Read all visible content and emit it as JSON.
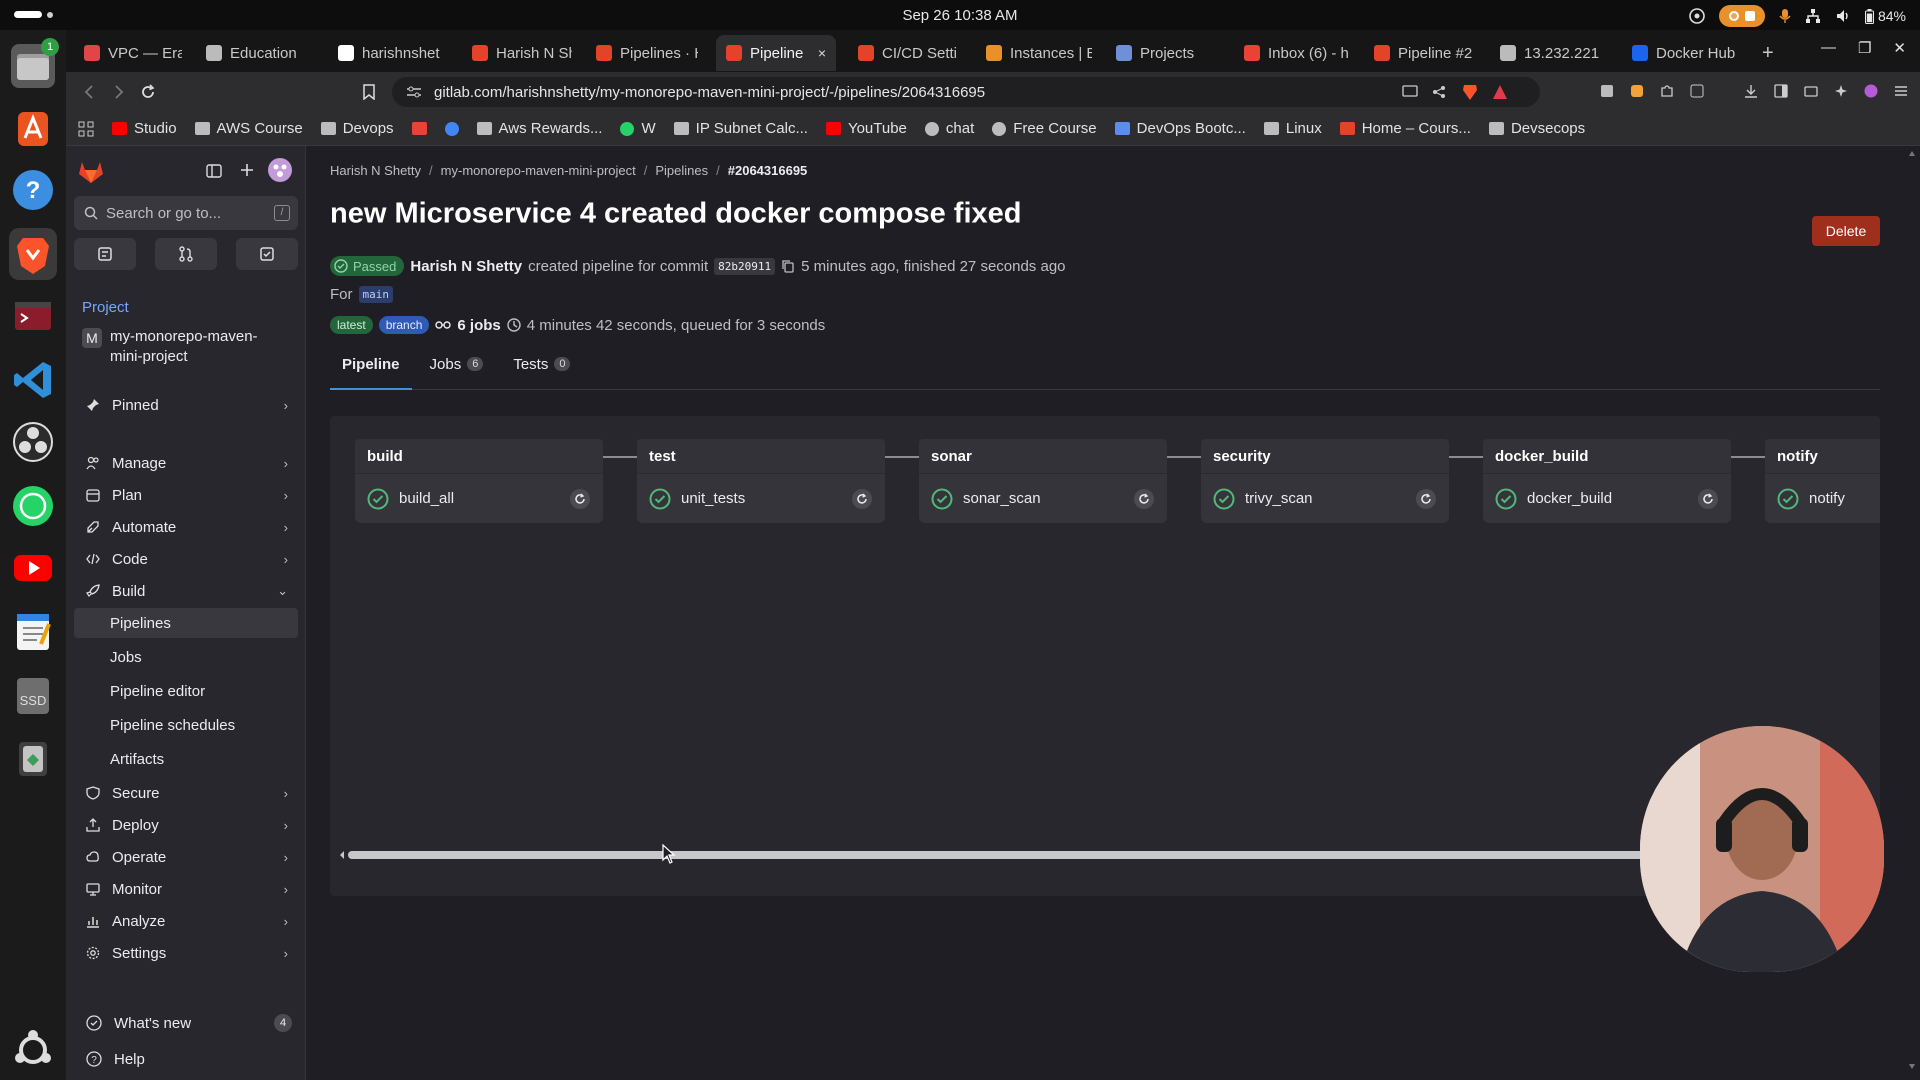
{
  "system": {
    "clock": "Sep 26  10:38 AM",
    "battery": "84%",
    "dock_badge": "1"
  },
  "browser": {
    "tabs": [
      {
        "label": "VPC — Eras",
        "color": "#e04646"
      },
      {
        "label": "Education",
        "color": "#bbbbbb"
      },
      {
        "label": "harishnshet",
        "color": "#ffffff"
      },
      {
        "label": "Harish N Sh",
        "color": "#e24329"
      },
      {
        "label": "Pipelines · H",
        "color": "#e24329"
      },
      {
        "label": "Pipeline",
        "color": "#e24329"
      },
      {
        "label": "CI/CD Setti",
        "color": "#e24329"
      },
      {
        "label": "Instances | E",
        "color": "#e8902a"
      },
      {
        "label": "Projects",
        "color": "#6f8fd6"
      },
      {
        "label": "Inbox (6) - h",
        "color": "#ea4335"
      },
      {
        "label": "Pipeline #2",
        "color": "#e24329"
      },
      {
        "label": "13.232.221",
        "color": "#bbbbbb"
      },
      {
        "label": "Docker Hub",
        "color": "#1d63ed"
      }
    ],
    "active_tab_close": "×",
    "new_tab": "+",
    "url": "gitlab.com/harishnshetty/my-monorepo-maven-mini-project/-/pipelines/2064316695",
    "bookmarks": [
      {
        "label": "Studio",
        "color": "#ff0000"
      },
      {
        "label": "AWS Course",
        "color": "#bcbcbc"
      },
      {
        "label": "Devops",
        "color": "#bcbcbc"
      },
      {
        "label": "",
        "color": "#ea4335"
      },
      {
        "label": "",
        "color": "#4285f4"
      },
      {
        "label": "Aws Rewards...",
        "color": "#bcbcbc"
      },
      {
        "label": "W",
        "color": "#25d366"
      },
      {
        "label": "IP Subnet Calc...",
        "color": "#bcbcbc"
      },
      {
        "label": "YouTube",
        "color": "#ff0000"
      },
      {
        "label": "chat",
        "color": "#bcbcbc"
      },
      {
        "label": "Free Course",
        "color": "#bcbcbc"
      },
      {
        "label": "DevOps Bootc...",
        "color": "#5b8def"
      },
      {
        "label": "Linux",
        "color": "#bcbcbc"
      },
      {
        "label": "Home – Cours...",
        "color": "#e24329"
      },
      {
        "label": "Devsecops",
        "color": "#bcbcbc"
      }
    ]
  },
  "sidebar": {
    "search_placeholder": "Search or go to...",
    "search_kbd": "/",
    "section_label": "Project",
    "project_initial": "M",
    "project_name_line1": "my-monorepo-maven-",
    "project_name_line2": "mini-project",
    "pinned": "Pinned",
    "items": [
      {
        "label": "Manage",
        "icon": "users-icon"
      },
      {
        "label": "Plan",
        "icon": "calendar-icon"
      },
      {
        "label": "Automate",
        "icon": "rocket-icon"
      },
      {
        "label": "Code",
        "icon": "code-icon"
      },
      {
        "label": "Build",
        "icon": "rocket-icon"
      }
    ],
    "build_sub": [
      "Pipelines",
      "Jobs",
      "Pipeline editor",
      "Pipeline schedules",
      "Artifacts"
    ],
    "lower_items": [
      {
        "label": "Secure",
        "icon": "shield-icon"
      },
      {
        "label": "Deploy",
        "icon": "deploy-icon"
      },
      {
        "label": "Operate",
        "icon": "cloud-icon"
      },
      {
        "label": "Monitor",
        "icon": "monitor-icon"
      },
      {
        "label": "Analyze",
        "icon": "chart-icon"
      },
      {
        "label": "Settings",
        "icon": "gear-icon"
      }
    ],
    "whats_new": "What's new",
    "whats_new_count": "4",
    "help": "Help"
  },
  "breadcrumb": [
    "Harish N Shetty",
    "my-monorepo-maven-mini-project",
    "Pipelines",
    "#2064316695"
  ],
  "pipeline": {
    "title": "new Microservice 4 created docker compose fixed",
    "delete_label": "Delete",
    "status": "Passed",
    "author": "Harish N Shetty",
    "created_text": "created pipeline for commit",
    "commit": "82b20911",
    "timing": "5 minutes ago, finished 27 seconds ago",
    "for_label": "For",
    "branch": "main",
    "tag_latest": "latest",
    "tag_branch": "branch",
    "jobs_text": "6 jobs",
    "duration_text": "4 minutes 42 seconds, queued for 3 seconds",
    "tabs": [
      {
        "label": "Pipeline",
        "count": ""
      },
      {
        "label": "Jobs",
        "count": "6"
      },
      {
        "label": "Tests",
        "count": "0"
      }
    ],
    "stages": [
      {
        "name": "build",
        "job": "build_all"
      },
      {
        "name": "test",
        "job": "unit_tests"
      },
      {
        "name": "sonar",
        "job": "sonar_scan"
      },
      {
        "name": "security",
        "job": "trivy_scan"
      },
      {
        "name": "docker_build",
        "job": "docker_build"
      },
      {
        "name": "notify",
        "job": "notify"
      }
    ],
    "colors": {
      "success": "#52b87a",
      "danger": "#a02e1c",
      "link": "#428fdc"
    }
  }
}
